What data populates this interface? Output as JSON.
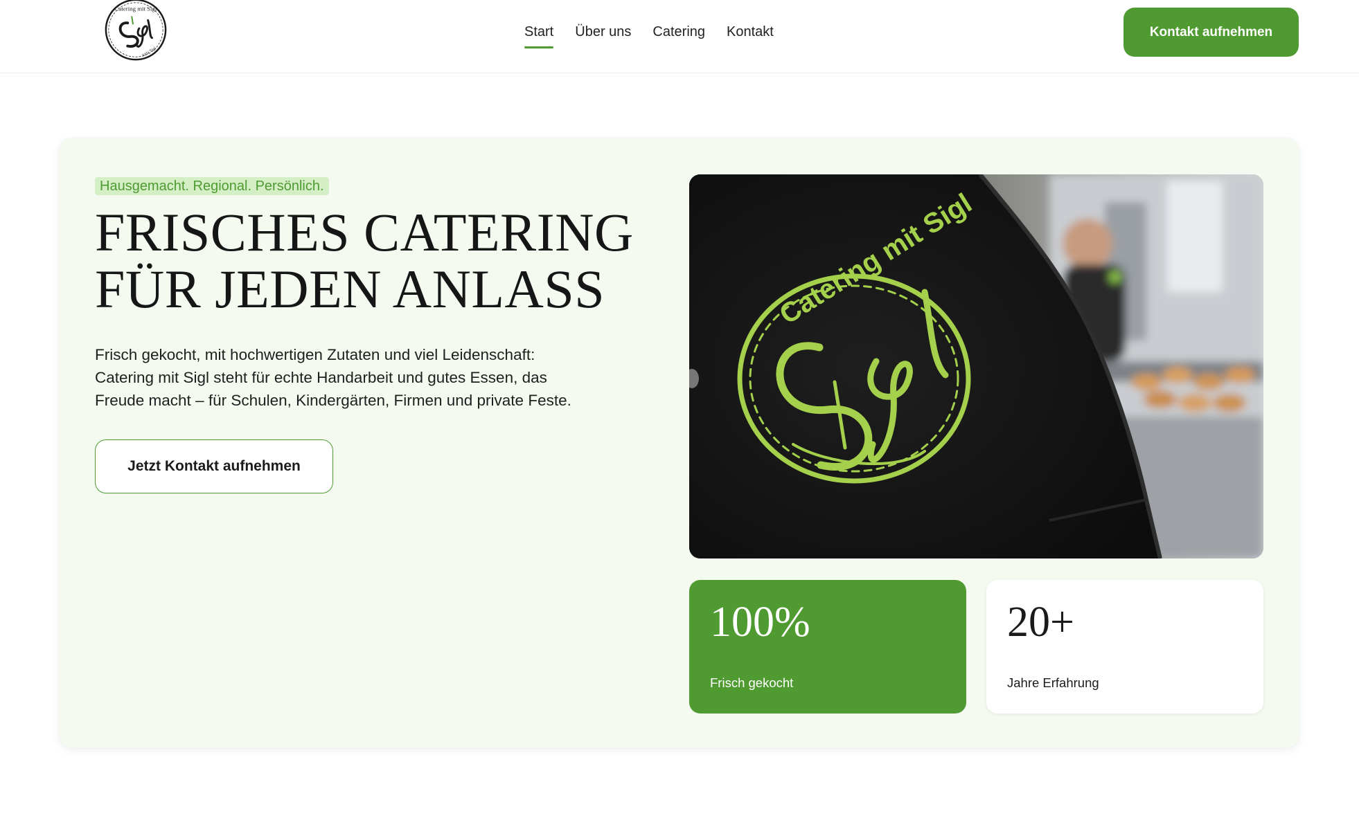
{
  "header": {
    "logo_text": "Catering mit Sigl",
    "logo_subtext": "Jutta Sigl",
    "nav": [
      {
        "label": "Start",
        "active": true
      },
      {
        "label": "Über uns",
        "active": false
      },
      {
        "label": "Catering",
        "active": false
      },
      {
        "label": "Kontakt",
        "active": false
      }
    ],
    "cta_label": "Kontakt aufnehmen"
  },
  "hero": {
    "badge": "Hausgemacht. Regional. Persönlich.",
    "title_lines": [
      "FRISCHES CATERING",
      "FÜR JEDEN ANLASS"
    ],
    "lead_lines": [
      "Frisch gekocht, mit hochwertigen Zutaten und viel Leidenschaft:",
      "Catering mit Sigl steht für echte Handarbeit und gutes Essen, das",
      "Freude macht – für Schulen, Kindergärten, Firmen und private Feste."
    ],
    "button_label": "Jetzt Kontakt aufnehmen",
    "photo_embroidery": "Catering mit Sigl",
    "stats": [
      {
        "value": "100%",
        "label": "Frisch gekocht"
      },
      {
        "value": "20+",
        "label": "Jahre Erfahrung"
      }
    ]
  },
  "colors": {
    "accent": "#4f9a31",
    "hero_bg": "#f4faf0",
    "badge_bg": "#d4eec6",
    "embroidery": "#a4d04c"
  },
  "icons": {
    "logo": "catering-mit-sigl-logo",
    "photo": "embroidered-chef-jacket-photo"
  }
}
